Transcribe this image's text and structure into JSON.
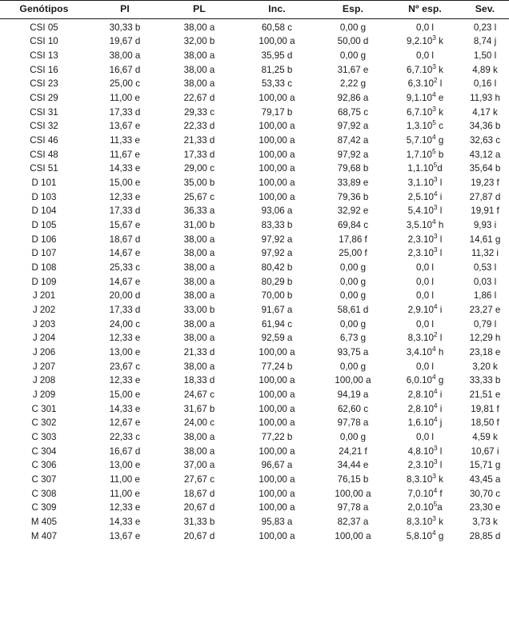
{
  "table": {
    "columns": [
      {
        "key": "genotipo",
        "label": "Genótipos"
      },
      {
        "key": "pi",
        "label": "PI"
      },
      {
        "key": "pl",
        "label": "PL"
      },
      {
        "key": "inc",
        "label": "Inc."
      },
      {
        "key": "esp",
        "label": "Esp."
      },
      {
        "key": "nesp",
        "label": "Nº esp."
      },
      {
        "key": "sev",
        "label": "Sev."
      }
    ],
    "rows": [
      {
        "genotipo": "CSI 05",
        "pi": "30,33 b",
        "pl": "38,00 a",
        "inc": "60,58 c",
        "esp": "0,00 g",
        "nesp_mant": "0,0",
        "nesp_exp": "",
        "nesp_letter": " l",
        "sev": "0,23 l"
      },
      {
        "genotipo": "CSI 10",
        "pi": "19,67 d",
        "pl": "32,00 b",
        "inc": "100,00 a",
        "esp": "50,00 d",
        "nesp_mant": "9,2.10",
        "nesp_exp": "3",
        "nesp_letter": " k",
        "sev": "8,74 j"
      },
      {
        "genotipo": "CSI 13",
        "pi": "38,00 a",
        "pl": "38,00 a",
        "inc": "35,95 d",
        "esp": "0,00 g",
        "nesp_mant": "0,0",
        "nesp_exp": "",
        "nesp_letter": " l",
        "sev": "1,50 l"
      },
      {
        "genotipo": "CSI 16",
        "pi": "16,67 d",
        "pl": "38,00 a",
        "inc": "81,25 b",
        "esp": "31,67 e",
        "nesp_mant": "6,7.10",
        "nesp_exp": "3",
        "nesp_letter": " k",
        "sev": "4,89 k"
      },
      {
        "genotipo": "CSI 23",
        "pi": "25,00 c",
        "pl": "38,00 a",
        "inc": "53,33 c",
        "esp": "2,22 g",
        "nesp_mant": "6,3.10",
        "nesp_exp": "2",
        "nesp_letter": " l",
        "sev": "0,16 l"
      },
      {
        "genotipo": "CSI 29",
        "pi": "11,00 e",
        "pl": "22,67 d",
        "inc": "100,00 a",
        "esp": "92,86 a",
        "nesp_mant": "9,1.10",
        "nesp_exp": "4",
        "nesp_letter": " e",
        "sev": "11,93 h"
      },
      {
        "genotipo": "CSI 31",
        "pi": "17,33 d",
        "pl": "29,33 c",
        "inc": "79,17 b",
        "esp": "68,75 c",
        "nesp_mant": "6,7.10",
        "nesp_exp": "3",
        "nesp_letter": " k",
        "sev": "4,17 k"
      },
      {
        "genotipo": "CSI 32",
        "pi": "13,67 e",
        "pl": "22,33 d",
        "inc": "100,00 a",
        "esp": "97,92 a",
        "nesp_mant": "1,3.10",
        "nesp_exp": "5",
        "nesp_letter": " c",
        "sev": "34,36 b"
      },
      {
        "genotipo": "CSI 46",
        "pi": "11,33 e",
        "pl": "21,33 d",
        "inc": "100,00 a",
        "esp": "87,42 a",
        "nesp_mant": "5,7.10",
        "nesp_exp": "4",
        "nesp_letter": " g",
        "sev": "32,63 c"
      },
      {
        "genotipo": "CSI 48",
        "pi": "11,67 e",
        "pl": "17,33 d",
        "inc": "100,00 a",
        "esp": "97,92 a",
        "nesp_mant": "1,7.10",
        "nesp_exp": "5",
        "nesp_letter": " b",
        "sev": "43,12 a"
      },
      {
        "genotipo": "CSI 51",
        "pi": "14,33 e",
        "pl": "29,00 c",
        "inc": "100,00 a",
        "esp": "79,68 b",
        "nesp_mant": "1,1.10",
        "nesp_exp": "5",
        "nesp_letter": "d",
        "sev": "35,64 b"
      },
      {
        "genotipo": "D 101",
        "pi": "15,00 e",
        "pl": "35,00 b",
        "inc": "100,00 a",
        "esp": "33,89 e",
        "nesp_mant": "3,1.10",
        "nesp_exp": "3",
        "nesp_letter": " l",
        "sev": "19,23 f"
      },
      {
        "genotipo": "D 103",
        "pi": "12,33 e",
        "pl": "25,67 c",
        "inc": "100,00 a",
        "esp": "79,36 b",
        "nesp_mant": "2,5.10",
        "nesp_exp": "4",
        "nesp_letter": " i",
        "sev": "27,87 d"
      },
      {
        "genotipo": "D 104",
        "pi": "17,33 d",
        "pl": "36,33 a",
        "inc": "93,06 a",
        "esp": "32,92 e",
        "nesp_mant": "5,4.10",
        "nesp_exp": "3",
        "nesp_letter": " l",
        "sev": "19,91 f"
      },
      {
        "genotipo": "D 105",
        "pi": "15,67 e",
        "pl": "31,00 b",
        "inc": "83,33 b",
        "esp": "69,84 c",
        "nesp_mant": "3,5.10",
        "nesp_exp": "4",
        "nesp_letter": " h",
        "sev": "9,93 i"
      },
      {
        "genotipo": "D 106",
        "pi": "18,67 d",
        "pl": "38,00 a",
        "inc": "97,92 a",
        "esp": "17,86 f",
        "nesp_mant": "2,3.10",
        "nesp_exp": "3",
        "nesp_letter": " l",
        "sev": "14,61 g"
      },
      {
        "genotipo": "D 107",
        "pi": "14,67 e",
        "pl": "38,00 a",
        "inc": "97,92 a",
        "esp": "25,00 f",
        "nesp_mant": "2,3.10",
        "nesp_exp": "3",
        "nesp_letter": " l",
        "sev": "11,32 i"
      },
      {
        "genotipo": "D 108",
        "pi": "25,33 c",
        "pl": "38,00 a",
        "inc": "80,42 b",
        "esp": "0,00 g",
        "nesp_mant": "0,0",
        "nesp_exp": "",
        "nesp_letter": " l",
        "sev": "0,53 l"
      },
      {
        "genotipo": "D 109",
        "pi": "14,67 e",
        "pl": "38,00 a",
        "inc": "80,29 b",
        "esp": "0,00 g",
        "nesp_mant": "0,0",
        "nesp_exp": "",
        "nesp_letter": " l",
        "sev": "0,03 l"
      },
      {
        "genotipo": "J 201",
        "pi": "20,00 d",
        "pl": "38,00 a",
        "inc": "70,00 b",
        "esp": "0,00 g",
        "nesp_mant": "0,0",
        "nesp_exp": "",
        "nesp_letter": " l",
        "sev": "1,86 l"
      },
      {
        "genotipo": "J 202",
        "pi": "17,33 d",
        "pl": "33,00 b",
        "inc": "91,67 a",
        "esp": "58,61 d",
        "nesp_mant": "2,9.10",
        "nesp_exp": "4",
        "nesp_letter": " i",
        "sev": "23,27 e"
      },
      {
        "genotipo": "J 203",
        "pi": "24,00 c",
        "pl": "38,00 a",
        "inc": "61,94 c",
        "esp": "0,00 g",
        "nesp_mant": "0,0",
        "nesp_exp": "",
        "nesp_letter": " l",
        "sev": "0,79 l"
      },
      {
        "genotipo": "J 204",
        "pi": "12,33 e",
        "pl": "38,00 a",
        "inc": "92,59 a",
        "esp": "6,73 g",
        "nesp_mant": "8,3.10",
        "nesp_exp": "2",
        "nesp_letter": " l",
        "sev": "12,29 h"
      },
      {
        "genotipo": "J 206",
        "pi": "13,00 e",
        "pl": "21,33 d",
        "inc": "100,00 a",
        "esp": "93,75 a",
        "nesp_mant": "3,4.10",
        "nesp_exp": "4",
        "nesp_letter": " h",
        "sev": "23,18 e"
      },
      {
        "genotipo": "J 207",
        "pi": "23,67 c",
        "pl": "38,00 a",
        "inc": "77,24 b",
        "esp": "0,00 g",
        "nesp_mant": "0,0",
        "nesp_exp": "",
        "nesp_letter": " l",
        "sev": "3,20 k"
      },
      {
        "genotipo": "J 208",
        "pi": "12,33 e",
        "pl": "18,33 d",
        "inc": "100,00 a",
        "esp": "100,00 a",
        "nesp_mant": "6,0.10",
        "nesp_exp": "4",
        "nesp_letter": " g",
        "sev": "33,33 b"
      },
      {
        "genotipo": "J 209",
        "pi": "15,00 e",
        "pl": "24,67 c",
        "inc": "100,00 a",
        "esp": "94,19 a",
        "nesp_mant": "2,8.10",
        "nesp_exp": "4",
        "nesp_letter": " i",
        "sev": "21,51 e"
      },
      {
        "genotipo": "C 301",
        "pi": "14,33 e",
        "pl": "31,67 b",
        "inc": "100,00 a",
        "esp": "62,60 c",
        "nesp_mant": "2,8.10",
        "nesp_exp": "4",
        "nesp_letter": " i",
        "sev": "19,81 f"
      },
      {
        "genotipo": "C 302",
        "pi": "12,67 e",
        "pl": "24,00 c",
        "inc": "100,00 a",
        "esp": "97,78 a",
        "nesp_mant": "1,6.10",
        "nesp_exp": "4",
        "nesp_letter": " j",
        "sev": "18,50 f"
      },
      {
        "genotipo": "C 303",
        "pi": "22,33 c",
        "pl": "38,00 a",
        "inc": "77,22 b",
        "esp": "0,00 g",
        "nesp_mant": "0,0",
        "nesp_exp": "",
        "nesp_letter": " l",
        "sev": "4,59 k"
      },
      {
        "genotipo": "C 304",
        "pi": "16,67 d",
        "pl": "38,00 a",
        "inc": "100,00 a",
        "esp": "24,21 f",
        "nesp_mant": "4,8.10",
        "nesp_exp": "3",
        "nesp_letter": " l",
        "sev": "10,67 i"
      },
      {
        "genotipo": "C 306",
        "pi": "13,00 e",
        "pl": "37,00 a",
        "inc": "96,67 a",
        "esp": "34,44 e",
        "nesp_mant": "2,3.10",
        "nesp_exp": "3",
        "nesp_letter": " l",
        "sev": "15,71 g"
      },
      {
        "genotipo": "C 307",
        "pi": "11,00 e",
        "pl": "27,67 c",
        "inc": "100,00 a",
        "esp": "76,15 b",
        "nesp_mant": "8,3.10",
        "nesp_exp": "3",
        "nesp_letter": " k",
        "sev": "43,45 a"
      },
      {
        "genotipo": "C 308",
        "pi": "11,00 e",
        "pl": "18,67 d",
        "inc": "100,00 a",
        "esp": "100,00 a",
        "nesp_mant": "7,0.10",
        "nesp_exp": "4",
        "nesp_letter": " f",
        "sev": "30,70 c"
      },
      {
        "genotipo": "C 309",
        "pi": "12,33 e",
        "pl": "20,67 d",
        "inc": "100,00 a",
        "esp": "97,78 a",
        "nesp_mant": "2,0.10",
        "nesp_exp": "5",
        "nesp_letter": "a",
        "sev": "23,30 e"
      },
      {
        "genotipo": "M 405",
        "pi": "14,33 e",
        "pl": "31,33 b",
        "inc": "95,83 a",
        "esp": "82,37 a",
        "nesp_mant": "8,3.10",
        "nesp_exp": "3",
        "nesp_letter": " k",
        "sev": "3,73 k"
      },
      {
        "genotipo": "M 407",
        "pi": "13,67 e",
        "pl": "20,67 d",
        "inc": "100,00 a",
        "esp": "100,00 a",
        "nesp_mant": "5,8.10",
        "nesp_exp": "4",
        "nesp_letter": " g",
        "sev": "28,85 d"
      }
    ]
  },
  "colors": {
    "text": "#1a1a1a",
    "rule": "#1a1a1a",
    "background": "#ffffff"
  }
}
